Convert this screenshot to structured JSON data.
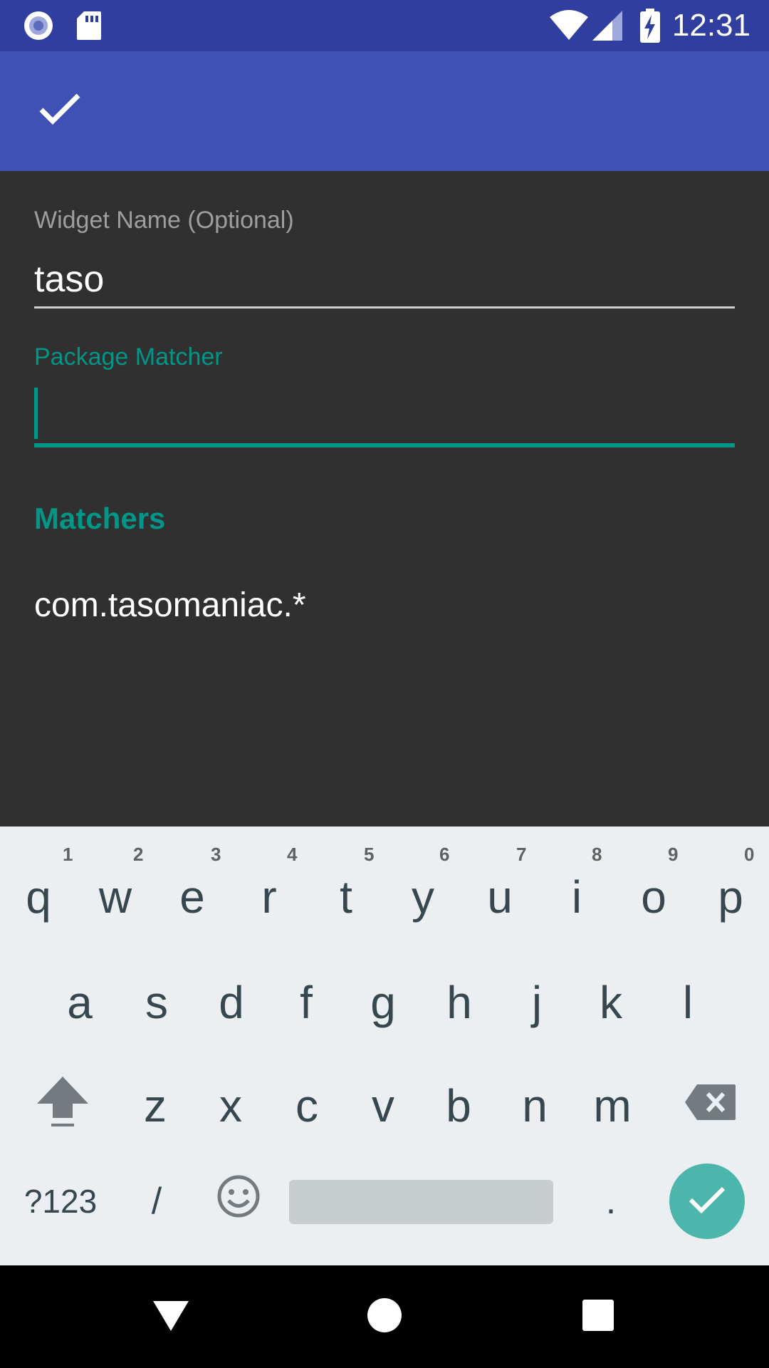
{
  "status_bar": {
    "time": "12:31",
    "icons": [
      "notification-circle-icon",
      "sd-card-icon",
      "wifi-icon",
      "cell-signal-icon",
      "battery-charging-icon"
    ]
  },
  "app_bar": {
    "confirm_icon": "check-icon"
  },
  "form": {
    "widget_name_label": "Widget Name (Optional)",
    "widget_name_value": "taso",
    "package_matcher_label": "Package Matcher",
    "package_matcher_value": ""
  },
  "matchers": {
    "header": "Matchers",
    "items": [
      "com.tasomaniac.*"
    ]
  },
  "keyboard": {
    "row1": [
      "q",
      "w",
      "e",
      "r",
      "t",
      "y",
      "u",
      "i",
      "o",
      "p"
    ],
    "row1_hints": [
      "1",
      "2",
      "3",
      "4",
      "5",
      "6",
      "7",
      "8",
      "9",
      "0"
    ],
    "row2": [
      "a",
      "s",
      "d",
      "f",
      "g",
      "h",
      "j",
      "k",
      "l"
    ],
    "row3": [
      "z",
      "x",
      "c",
      "v",
      "b",
      "n",
      "m"
    ],
    "symbols_label": "?123",
    "slash_label": "/",
    "period_label": ".",
    "icons": [
      "shift-icon",
      "backspace-icon",
      "emoji-icon",
      "enter-check-icon"
    ],
    "accent_color": "#4db6ac"
  },
  "navigation": {
    "icons": [
      "back-icon",
      "home-icon",
      "recents-icon"
    ]
  },
  "colors": {
    "status_bar": "#303f9f",
    "app_bar": "#3f51b5",
    "accent": "#009688",
    "background": "#303030"
  }
}
